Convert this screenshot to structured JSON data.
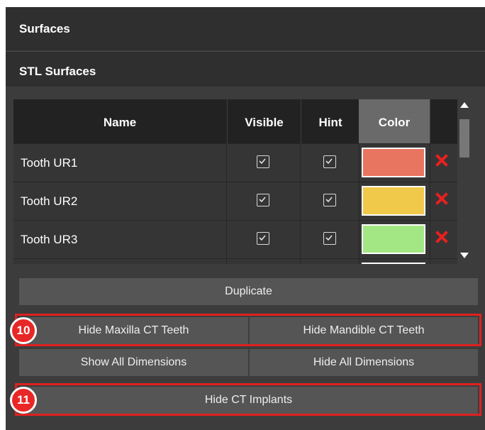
{
  "panel": {
    "title": "Surfaces",
    "section_title": "STL Surfaces"
  },
  "table": {
    "headers": {
      "name": "Name",
      "visible": "Visible",
      "hint": "Hint",
      "color": "Color"
    },
    "rows": [
      {
        "name": "Tooth UR1",
        "visible": true,
        "hint": true,
        "color": "#e87560"
      },
      {
        "name": "Tooth UR2",
        "visible": true,
        "hint": true,
        "color": "#f1c94a"
      },
      {
        "name": "Tooth UR3",
        "visible": true,
        "hint": true,
        "color": "#a3e785"
      },
      {
        "name": "",
        "visible": true,
        "hint": true,
        "color": "#e060b0"
      }
    ]
  },
  "buttons": {
    "duplicate": "Duplicate",
    "hide_maxilla": "Hide Maxilla CT Teeth",
    "hide_mandible": "Hide Mandible CT Teeth",
    "show_all_dimensions": "Show All Dimensions",
    "hide_all_dimensions": "Hide All Dimensions",
    "hide_ct_implants": "Hide CT Implants"
  },
  "annotations": {
    "badge_10": "10",
    "badge_11": "11",
    "color": "#e02020"
  },
  "icons": {
    "check": "checkbox-check-icon",
    "delete": "red-x-icon",
    "scroll_up": "triangle-up",
    "scroll_down": "triangle-down"
  }
}
